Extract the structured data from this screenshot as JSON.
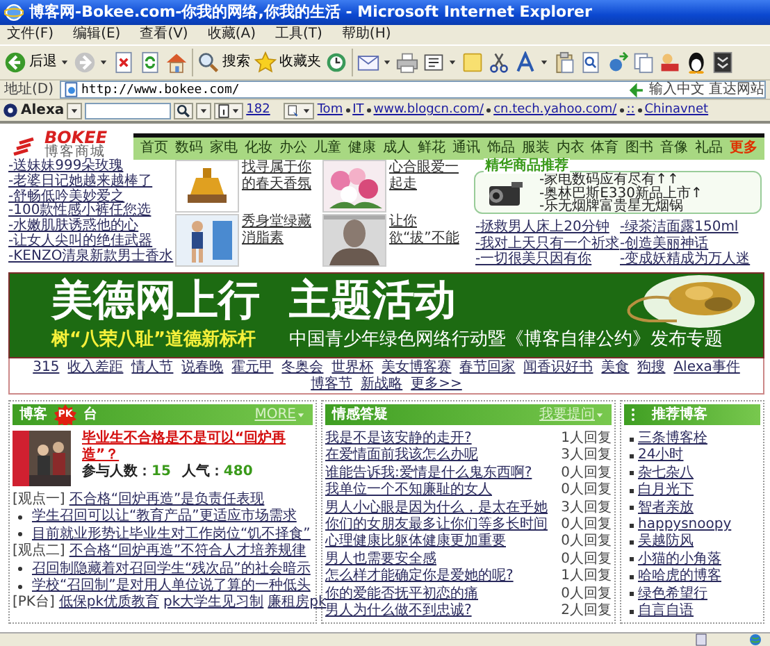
{
  "window": {
    "title": "博客网-Bokee.com-你我的网络,你我的生活 - Microsoft Internet Explorer"
  },
  "menu": [
    "文件(F)",
    "编辑(E)",
    "查看(V)",
    "收藏(A)",
    "工具(T)",
    "帮助(H)"
  ],
  "toolbar": {
    "back": "后退",
    "search": "搜索",
    "favorites": "收藏夹"
  },
  "address": {
    "label": "地址(D)",
    "url": "http://www.bokee.com/",
    "go": "输入中文 直达网站"
  },
  "alexa": {
    "brand": "Alexa",
    "rank": "182",
    "links": [
      "Tom",
      "IT",
      "www.blogcn.com/",
      "cn.tech.yahoo.com/",
      "::",
      "Chinavnet"
    ]
  },
  "site": {
    "logo": {
      "brand": "BOKEE",
      "tagline": "博客商城"
    },
    "nav": [
      "首页",
      "数码",
      "家电",
      "化妆",
      "办公",
      "儿童",
      "健康",
      "成人",
      "鲜花",
      "通讯",
      "饰品",
      "服装",
      "内衣",
      "体育",
      "图书",
      "音像",
      "礼品"
    ],
    "nav_more": "更多",
    "left_links": [
      "-送妹妹999朵玫瑰",
      "-老婆日记她越来越棒了",
      "-舒畅低吟美妙爱之",
      "-100款性感小裤任您选",
      "-水嫩肌肤诱惑他的心",
      "-让女人尖叫的绝佳武器",
      "-KENZO清泉新款男士香水"
    ],
    "products": [
      {
        "caption": "找寻属于你的春天香氛"
      },
      {
        "caption": "心合眼爱一起走"
      },
      {
        "caption": "秀身堂绿藏消脂素"
      },
      {
        "caption": "让你欲“拔”不能"
      }
    ],
    "featured": {
      "title": "精华商品推荐",
      "items": [
        "-家电数码应有尽有↑↑",
        "-奥林巴斯E330新品上市↑",
        "-乐无烟牌富贵星无烟锅"
      ]
    },
    "promo_links": [
      "-拯救男人床上20分钟",
      "-绿茶洁面露150ml",
      "-我对上天只有一个祈求",
      "-创造美丽神话",
      "-一切很美只因有你",
      "-变成妖精成为万人迷"
    ],
    "banner": {
      "title": "美德网上行  主题活动",
      "slogan": "树“八荣八耻”道德新标杆",
      "subtitle": "中国青少年绿色网络行动暨《博客自律公约》发布专题"
    },
    "topics": [
      "315",
      "收入差距",
      "情人节",
      "说春晚",
      "霍元甲",
      "冬奥会",
      "世界杯",
      "美女博客赛",
      "春节回家",
      "闻香识好书",
      "美食",
      "狗搜",
      "Alexa事件",
      "博客节",
      "新战略",
      "更多>>"
    ],
    "pk": {
      "title_left": "博客",
      "badge": "PK",
      "title_right": "台",
      "more": "MORE",
      "question": "毕业生不合格是不是可以“回炉再造”？",
      "participants_label": "参与人数：",
      "participants": "15",
      "popularity_label": "人气：",
      "popularity": "480",
      "items": [
        {
          "kind": "view",
          "label": "[观点一]",
          "links": [
            "不合格“回炉再造”是负责任表现"
          ]
        },
        {
          "kind": "point",
          "links": [
            "学生召回可以让“教育产品”更适应市场需求"
          ]
        },
        {
          "kind": "point",
          "links": [
            "目前就业形势让毕业生对工作岗位“饥不择食”"
          ]
        },
        {
          "kind": "view",
          "label": "[观点二]",
          "links": [
            "不合格“回炉再造”不符合人才培养规律"
          ]
        },
        {
          "kind": "point",
          "links": [
            "召回制隐藏着对召回学生“残次品”的社会暗示"
          ]
        },
        {
          "kind": "point",
          "links": [
            "学校“召回制”是对用人单位说了算的一种低头"
          ]
        },
        {
          "kind": "more",
          "label": "[PK台]",
          "links": [
            "低保pk优质教育",
            "pk大学生见习制",
            "廉租房pk"
          ]
        }
      ]
    },
    "qa": {
      "title": "情感答疑",
      "ask": "我要提问",
      "rows": [
        {
          "question": "我是不是该安静的走开?",
          "replies": "1人回复"
        },
        {
          "question": "在爱情面前我该怎么办呢",
          "replies": "3人回复"
        },
        {
          "question": "谁能告诉我:爱情是什么鬼东西啊?",
          "replies": "0人回复"
        },
        {
          "question": "我单位一个不知廉耻的女人",
          "replies": "0人回复"
        },
        {
          "question": "男人小心眼是因为什么，是太在乎她",
          "replies": "3人回复"
        },
        {
          "question": "你们的女朋友最多让你们等多长时间",
          "replies": "0人回复"
        },
        {
          "question": "心理健康比躯体健康更加重要",
          "replies": "0人回复"
        },
        {
          "question": "男人也需要安全感",
          "replies": "0人回复"
        },
        {
          "question": "怎么样才能确定你是爱她的呢?",
          "replies": "1人回复"
        },
        {
          "question": "你的爱能否抚平初恋的痛",
          "replies": "0人回复"
        },
        {
          "question": "男人为什么做不到忠诚?",
          "replies": "2人回复"
        }
      ]
    },
    "blogs": {
      "title": "推荐博客",
      "items": [
        "三条博客栓",
        "24小时",
        "杂七杂八",
        "白月光下",
        "智者亲放",
        "happysnoopy",
        "吴越防风",
        "小猫的小角落",
        "哈哈虎的博客",
        "绿色希望行",
        "自言自语"
      ]
    }
  }
}
